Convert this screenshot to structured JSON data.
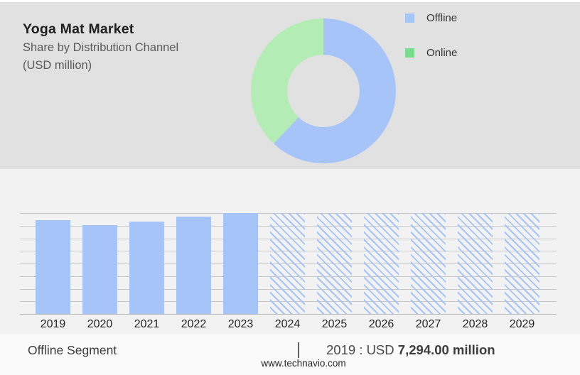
{
  "header": {
    "title": "Yoga Mat Market",
    "subtitle_line1": "Share by Distribution Channel",
    "subtitle_line2": "(USD million)"
  },
  "legend": {
    "items": [
      {
        "label": "Offline",
        "color": "#A6C7F6"
      },
      {
        "label": "Online",
        "color": "#77DC8D"
      }
    ]
  },
  "footer": {
    "segment_label": "Offline Segment",
    "separator": "|",
    "value_prefix": "2019 : USD ",
    "value_bold": "7,294.00 million",
    "website": "www.technavio.com"
  },
  "colors": {
    "top_bg": "#E1E1E2",
    "bottom_bg": "#F2F2F3",
    "footer_bg": "#FAFAFB",
    "bar_blue": "#A6C4F7",
    "donut_green": "#B3ECB5",
    "gridline": "#C8C8C8",
    "axis": "#B7B7B7"
  },
  "chart_data": [
    {
      "type": "pie",
      "donut": true,
      "title": "Yoga Mat Market — Share by Distribution Channel (USD million)",
      "labels": [
        "Offline",
        "Online"
      ],
      "values_pct": [
        62,
        38
      ],
      "colors": [
        "#A6C4F7",
        "#B3ECB5"
      ],
      "start_angle": "top",
      "direction": "clockwise",
      "legend_position": "right"
    },
    {
      "type": "bar",
      "categories": [
        "2019",
        "2020",
        "2021",
        "2022",
        "2023",
        "2024",
        "2025",
        "2026",
        "2027",
        "2028",
        "2029"
      ],
      "values_relative": [
        0.93,
        0.88,
        0.915,
        0.965,
        1.0,
        1.0,
        1.0,
        1.0,
        1.0,
        1.0,
        1.0
      ],
      "is_forecast_hatched": [
        false,
        false,
        false,
        false,
        false,
        true,
        true,
        true,
        true,
        true,
        true
      ],
      "known_values": {
        "2019": "USD 7,294.00 million"
      },
      "series_name": "Offline Segment",
      "xlabel": "",
      "ylabel": "",
      "y_axis_labels_visible": false,
      "gridline_count": 9,
      "grid": true,
      "legend_position": "none"
    }
  ]
}
